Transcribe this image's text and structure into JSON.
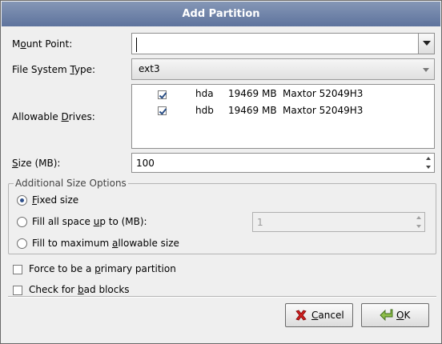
{
  "dialog": {
    "title": "Add Partition"
  },
  "mount_point": {
    "label_pre": "M",
    "label_u": "o",
    "label_post": "unt Point:",
    "value": ""
  },
  "fs_type": {
    "label_pre": "File System ",
    "label_u": "T",
    "label_post": "ype:",
    "value": "ext3"
  },
  "drives": {
    "label_pre": "Allowable ",
    "label_u": "D",
    "label_post": "rives:",
    "rows": [
      {
        "checked": true,
        "name": "hda",
        "size": "19469 MB",
        "model": "Maxtor 52049H3"
      },
      {
        "checked": true,
        "name": "hdb",
        "size": "19469 MB",
        "model": "Maxtor 52049H3"
      }
    ]
  },
  "size": {
    "label_u": "S",
    "label_post": "ize (MB):",
    "value": "100"
  },
  "size_options": {
    "title": "Additional Size Options",
    "fixed": {
      "label_u": "F",
      "label_post": "ixed size",
      "selected": true
    },
    "fill_up_to": {
      "label_pre": "Fill all space ",
      "label_u": "u",
      "label_post": "p to (MB):",
      "selected": false,
      "value": "1"
    },
    "fill_max": {
      "label_pre": "Fill to maximum ",
      "label_u": "a",
      "label_post": "llowable size",
      "selected": false
    }
  },
  "primary": {
    "label_pre": "Force to be a ",
    "label_u": "p",
    "label_post": "rimary partition",
    "checked": false
  },
  "badblocks": {
    "label_pre": "Check for ",
    "label_u": "b",
    "label_post": "ad blocks",
    "checked": false
  },
  "buttons": {
    "cancel": {
      "label_u": "C",
      "label_post": "ancel"
    },
    "ok": {
      "label_u": "O",
      "label_post": "K"
    }
  },
  "icons": {
    "cancel": "x-icon",
    "ok": "enter-arrow-icon"
  }
}
